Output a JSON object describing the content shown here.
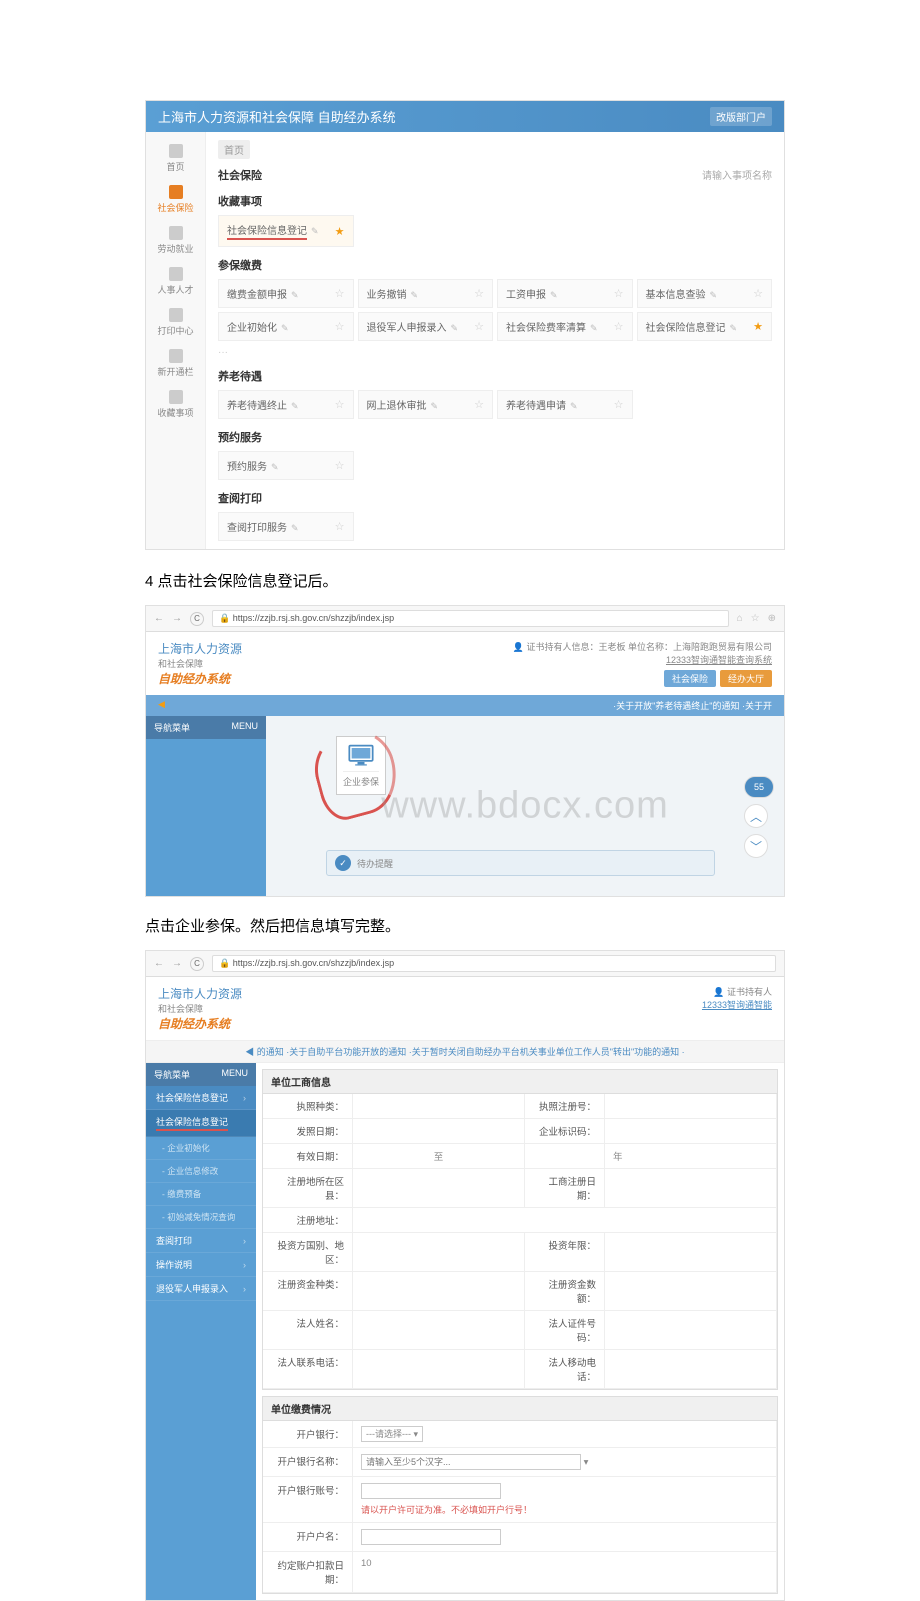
{
  "screenshot1": {
    "header_title": "上海市人力资源和社会保障 自助经办系统",
    "header_right": "改版部门户",
    "breadcrumb": {
      "home": "首页"
    },
    "sidebar": [
      {
        "label": "首页"
      },
      {
        "label": "社会保险"
      },
      {
        "label": "劳动就业"
      },
      {
        "label": "人事人才"
      },
      {
        "label": "打印中心"
      },
      {
        "label": "新开通栏"
      },
      {
        "label": "收藏事项"
      }
    ],
    "tab_label": "社会保险",
    "search_placeholder": "请输入事项名称",
    "sections": {
      "favorites": {
        "title": "收藏事项",
        "items": [
          {
            "label": "社会保险信息登记",
            "starred": true
          }
        ]
      },
      "insure": {
        "title": "参保缴费",
        "items": [
          {
            "label": "缴费金额申报"
          },
          {
            "label": "业务撤销"
          },
          {
            "label": "工资申报"
          },
          {
            "label": "基本信息查验"
          },
          {
            "label": "企业初始化"
          },
          {
            "label": "退役军人申报录入"
          },
          {
            "label": "社会保险费率清算"
          },
          {
            "label": "社会保险信息登记",
            "starred": true
          }
        ]
      },
      "pension": {
        "title": "养老待遇",
        "items": [
          {
            "label": "养老待遇终止"
          },
          {
            "label": "网上退休审批"
          },
          {
            "label": "养老待遇申请"
          }
        ]
      },
      "booking": {
        "title": "预约服务",
        "items": [
          {
            "label": "预约服务"
          }
        ]
      },
      "print": {
        "title": "查阅打印",
        "items": [
          {
            "label": "查阅打印服务"
          }
        ]
      }
    },
    "dots": "···"
  },
  "instruction1": "4 点击社会保险信息登记后。",
  "screenshot2": {
    "url": "https://zzjb.rsj.sh.gov.cn/shzzjb/index.jsp",
    "logo_top": "上海市人力资源",
    "logo_sub": "和社会保障",
    "logo_bold": "自助经办系统",
    "user_hint": "证书持有人信息：王老板  单位名称：上海陪跑跑贸易有限公司",
    "hotline": "12333智询通智能查询系统",
    "tab_blue": "社会保险",
    "tab_orange": "经办大厅",
    "notify_left": "",
    "notify_right": "·关于开放\"养老待遇终止\"的通知 ·关于开",
    "sidebar_head": "导航菜单",
    "sidebar_menu": "MENU",
    "monitor_label": "企业参保",
    "task_label": "待办提醒",
    "score": "55",
    "watermark": "www.bdocx.com"
  },
  "instruction2": "点击企业参保。然后把信息填写完整。",
  "screenshot3": {
    "url": "https://zzjb.rsj.sh.gov.cn/shzzjb/index.jsp",
    "logo_top": "上海市人力资源",
    "logo_sub": "和社会保障",
    "logo_bold": "自助经办系统",
    "user_hint": "证书持有人",
    "hotline": "12333智询通智能",
    "notify": "◀ 的通知  ·关于自助平台功能开放的通知  ·关于暂时关闭自助经办平台机关事业单位工作人员\"转出\"功能的通知  ·",
    "sidebar_head": "导航菜单",
    "sidebar_menu": "MENU",
    "nav": [
      {
        "label": "社会保险信息登记",
        "type": "head"
      },
      {
        "label": "社会保险信息登记",
        "type": "active"
      },
      {
        "label": "- 企业初始化",
        "type": "sub"
      },
      {
        "label": "- 企业信息修改",
        "type": "sub"
      },
      {
        "label": "- 缴费预备",
        "type": "sub"
      },
      {
        "label": "- 初始减免情况查询",
        "type": "sub"
      },
      {
        "label": "查阅打印",
        "type": "item"
      },
      {
        "label": "操作说明",
        "type": "item"
      },
      {
        "label": "退役军人申报录入",
        "type": "item"
      }
    ],
    "form1": {
      "title": "单位工商信息",
      "rows": [
        [
          "执照种类：",
          "",
          "执照注册号：",
          ""
        ],
        [
          "发照日期：",
          "",
          "企业标识码：",
          ""
        ],
        [
          "有效日期：",
          "至",
          "",
          "年"
        ],
        [
          "注册地所在区县：",
          "",
          "工商注册日期：",
          ""
        ],
        [
          "注册地址：",
          "__span3__",
          "",
          ""
        ],
        [
          "投资方国别、地区：",
          "",
          "投资年限：",
          ""
        ],
        [
          "注册资金种类：",
          "",
          "注册资金数额：",
          ""
        ],
        [
          "法人姓名：",
          "",
          "法人证件号码：",
          ""
        ],
        [
          "法人联系电话：",
          "",
          "法人移动电话：",
          ""
        ]
      ]
    },
    "form2": {
      "title": "单位缴费情况",
      "rows": [
        {
          "label": "开户银行：",
          "type": "select",
          "placeholder": "---请选择--- ▾"
        },
        {
          "label": "开户银行名称：",
          "type": "input_wide",
          "placeholder": "请输入至少5个汉字...",
          "suffix": "▾"
        },
        {
          "label": "开户银行账号：",
          "type": "input",
          "hint": "请以开户许可证为准。不必填如开户行号！"
        },
        {
          "label": "开户户名：",
          "type": "input"
        },
        {
          "label": "约定账户扣款日期：",
          "type": "text",
          "value": "10"
        }
      ]
    }
  }
}
